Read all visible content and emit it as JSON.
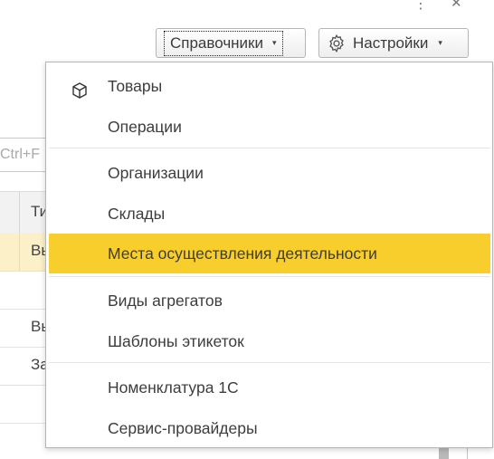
{
  "window_controls": {
    "more_glyph": "⋮",
    "close_glyph": "✕"
  },
  "toolbar": {
    "catalogs_label": "Справочники",
    "catalogs_caret": "▾",
    "settings_label": "Настройки",
    "settings_caret": "▾"
  },
  "background_list": {
    "search_placeholder_fragment": "Ctrl+F",
    "header_fragment": "Ти",
    "row_fragments": [
      "Вь",
      "",
      "Вь",
      "За"
    ]
  },
  "menu": {
    "items": [
      {
        "label": "Товары",
        "icon": "cube-icon"
      },
      {
        "label": "Операции"
      },
      {
        "label": "Организации"
      },
      {
        "label": "Склады"
      },
      {
        "label": "Места осуществления деятельности",
        "highlighted": true
      },
      {
        "label": "Виды агрегатов"
      },
      {
        "label": "Шаблоны этикеток"
      },
      {
        "label": "Номенклатура 1С"
      },
      {
        "label": "Сервис-провайдеры"
      }
    ]
  },
  "colors": {
    "highlight": "#f8ce2c",
    "selected_row": "#fbf0c8",
    "border": "#b5b5b5"
  }
}
